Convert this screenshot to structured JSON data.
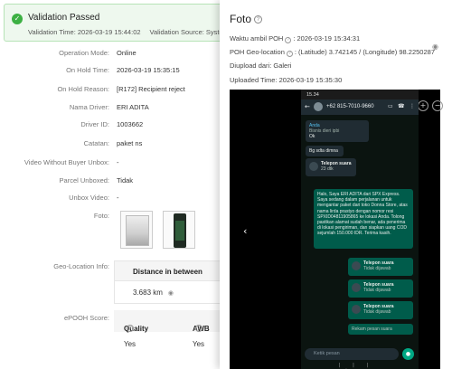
{
  "banner": {
    "title": "Validation Passed",
    "time_label": "Validation Time: 2026-03-19 15:44:02",
    "source_label": "Validation Source: System"
  },
  "details": {
    "operation_mode": {
      "label": "Operation Mode:",
      "value": "Online"
    },
    "on_hold_time": {
      "label": "On Hold Time:",
      "value": "2026-03-19 15:35:15"
    },
    "on_hold_reason": {
      "label": "On Hold Reason:",
      "value": "[R172] Recipient reject"
    },
    "driver_name": {
      "label": "Nama Driver:",
      "value": "ERI ADITA"
    },
    "driver_id": {
      "label": "Driver ID:",
      "value": "1003662"
    },
    "note": {
      "label": "Catatan:",
      "value": "paket ns"
    },
    "video_without_buyer": {
      "label": "Video Without Buyer Unbox:",
      "value": "-"
    },
    "parcel_unboxed": {
      "label": "Parcel Unboxed:",
      "value": "Tidak"
    },
    "unbox_video": {
      "label": "Unbox Video:",
      "value": "-"
    },
    "photo": {
      "label": "Foto:"
    },
    "geo_info": {
      "label": "Geo-Location Info:",
      "column": "Distance in between",
      "value": "3.683 km"
    },
    "epooh": {
      "label": "ePOOH Score:",
      "col_quality": "Quality",
      "col_awb": "AWB",
      "quality": "Yes",
      "awb": "Yes"
    }
  },
  "drawer": {
    "title": "Foto",
    "time_label": "Waktu ambil POH",
    "time_value": ": 2026-03-19 15:34:31",
    "geo_label": "POH Geo-location",
    "geo_value": ": (Latitude) 3.742145 / (Longitude) 98.2250287",
    "upload_src": "Diupload dari: Galeri",
    "uploaded_time": "Uploaded Time: 2026-03-19 15:35:30"
  },
  "phone": {
    "status_time": "15.34",
    "contact": "+62 815-7010-9660",
    "messages": {
      "m1_name": "Anda",
      "m1_sub": "Bisnis dieri ipbi",
      "m2": "Ok",
      "m3": "Bg sdta dimna",
      "call1_title": "Telepon suara",
      "call1_sub": "23 dtk",
      "long_text": "Halo, Saya ERI ADITA dari SPX Express. Saya sedang dalam perjalanan untuk mengantar paket dari toko Donna Store, atas nama lirda prastyo dengan nomor resi SPXID04811905865 ke lokasi Anda. Tolong pastikan alamat sudah benar, ada penerima di lokasi pengiriman, dan siapkan uang COD sejumlah 150.000 IDR. Terima kasih.",
      "call2_title": "Telepon suara",
      "call2_sub": "Tidak dijawab",
      "call3_title": "Telepon suara",
      "call3_sub": "Tidak dijawab",
      "call4_title": "Telepon suara",
      "call4_sub": "Tidak dijawab",
      "call5_sub": "Rekam pesan suara",
      "input_placeholder": "Ketik pesan"
    }
  },
  "colors": {
    "success": "#3cb043",
    "whatsapp_out": "#005c4b",
    "whatsapp_in": "#202c33"
  },
  "icons": [
    "check-circle-icon",
    "question-icon",
    "location-pin-icon",
    "close-icon",
    "arrow-left-icon",
    "zoom-in-icon",
    "zoom-out-icon",
    "phone-call-icon",
    "microphone-icon"
  ]
}
